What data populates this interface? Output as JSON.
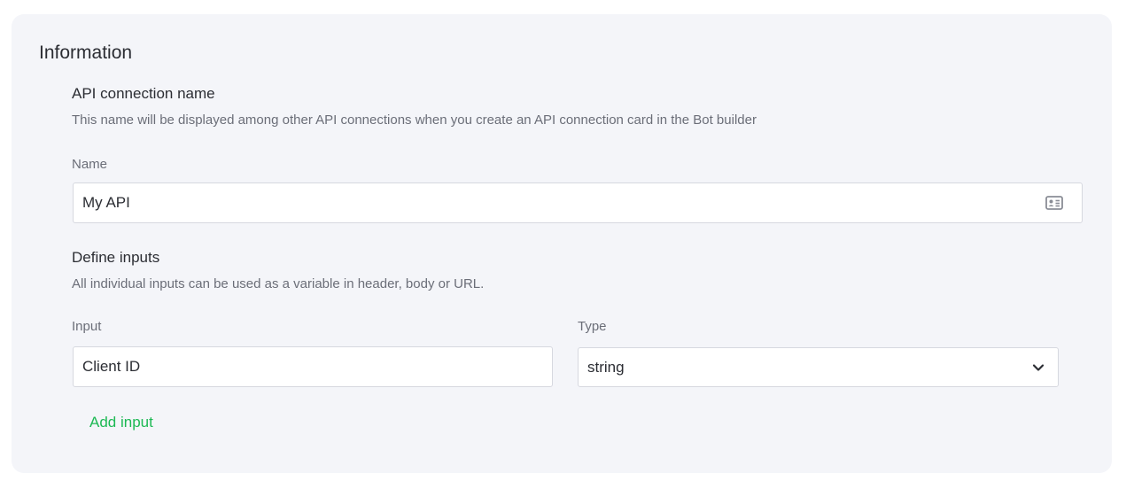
{
  "section": {
    "title": "Information"
  },
  "connection_name": {
    "heading": "API connection name",
    "hint": "This name will be displayed among other API connections when you create an API connection card in the Bot builder",
    "name_label": "Name",
    "name_value": "My API"
  },
  "inputs": {
    "heading": "Define inputs",
    "hint": "All individual inputs can be used as a variable in header, body or URL.",
    "input_label": "Input",
    "input_value": "Client ID",
    "type_label": "Type",
    "type_value": "string",
    "add_label": "Add input"
  },
  "colors": {
    "accent": "#1db954",
    "card_background": "#f4f5f9",
    "text_primary": "#2b2d33",
    "text_secondary": "#6b6e78",
    "border": "#d6d8df"
  },
  "icons": {
    "name_field_icon": "contact-card-icon",
    "type_dropdown_icon": "chevron-down-icon"
  }
}
